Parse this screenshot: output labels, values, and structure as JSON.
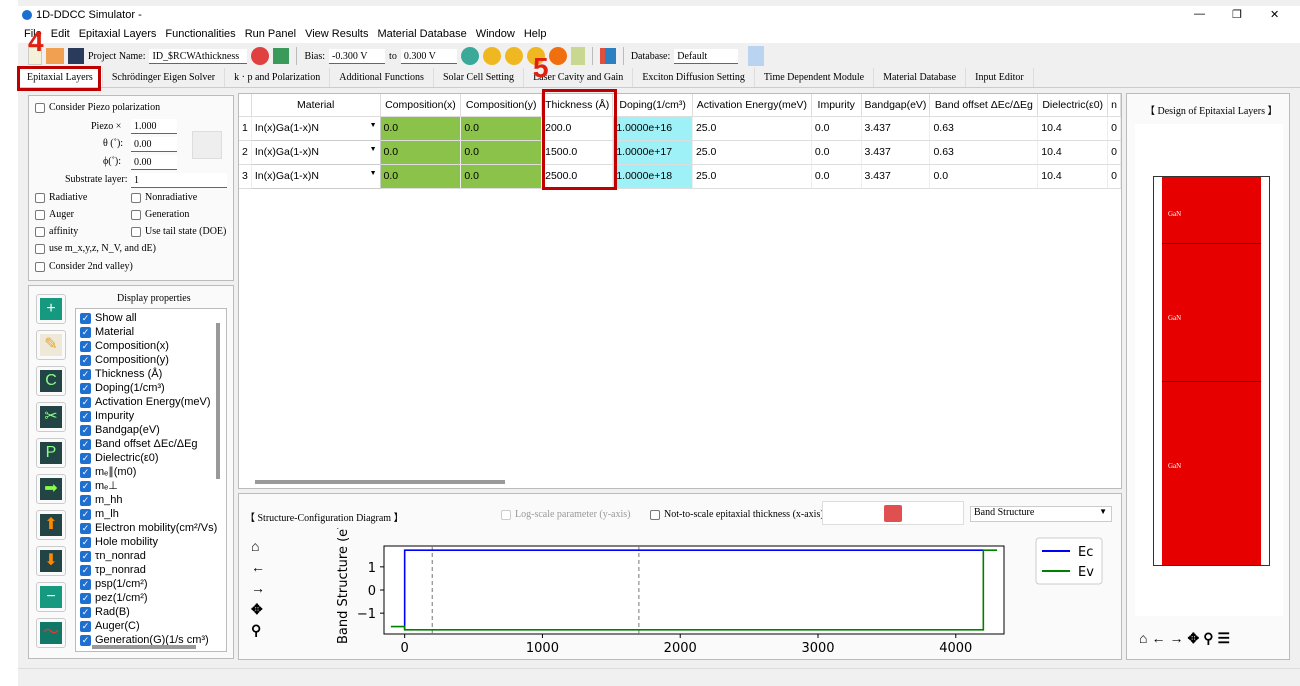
{
  "window": {
    "title": "1D-DDCC Simulator -",
    "controls": [
      "—",
      "❐",
      "✕"
    ]
  },
  "menu": [
    "File",
    "Edit",
    "Epitaxial Layers",
    "Functionalities",
    "Run Panel",
    "View Results",
    "Material Database",
    "Window",
    "Help"
  ],
  "toolbar": {
    "project_label": "Project Name:",
    "project_value": "ID_$RCWAthickness",
    "bias_label": "Bias:",
    "bias_from": "-0.300 V",
    "to_label": "to",
    "bias_to": "0.300 V",
    "database_label": "Database:",
    "database_value": "Default"
  },
  "tabs": [
    "Epitaxial Layers",
    "Schrödinger Eigen Solver",
    "k · p and Polarization",
    "Additional Functions",
    "Solar Cell Setting",
    "Laser Cavity and Gain",
    "Exciton Diffusion Setting",
    "Time Dependent Module",
    "Material Database",
    "Input Editor"
  ],
  "settings": {
    "piezo_check": "Consider Piezo polarization",
    "piezo_label": "Piezo ×",
    "piezo_value": "1.000",
    "theta_label": "θ (˚):",
    "theta_value": "0.00",
    "phi_label": "ϕ(˚):",
    "phi_value": "0.00",
    "substrate_label": "Substrate layer:",
    "substrate_value": "1",
    "checks": [
      "Radiative",
      "Nonradiative",
      "Auger",
      "Generation",
      "affinity",
      "Use tail state (DOE)"
    ],
    "check_mxyz": "use m_x,y,z, N_V, and dE)",
    "check_valley": "Consider 2nd valley)"
  },
  "display_properties": {
    "title": "Display properties",
    "items": [
      "Show all",
      "Material",
      "Composition(x)",
      "Composition(y)",
      "Thickness (Å)",
      "Doping(1/cm³)",
      "Activation Energy(meV)",
      "Impurity",
      "Bandgap(eV)",
      "Band offset ΔEc/ΔEg",
      "Dielectric(ε0)",
      "mₑ∥(m0)",
      "mₑ⊥",
      "m_hh",
      "m_lh",
      "Electron mobility(cm²/Vs)",
      "Hole mobility",
      "τn_nonrad",
      "τp_nonrad",
      "psp(1/cm²)",
      "pez(1/cm²)",
      "Rad(B)",
      "Auger(C)",
      "Generation(G)(1/s cm³)"
    ]
  },
  "side_buttons": [
    "add",
    "edit",
    "copy",
    "cut",
    "paste",
    "insert",
    "move-up",
    "move-down",
    "remove",
    "plot"
  ],
  "table": {
    "columns": [
      "Material",
      "Composition(x)",
      "Composition(y)",
      "Thickness (Å)",
      "Doping(1/cm³)",
      "Activation Energy(meV)",
      "Impurity",
      "Bandgap(eV)",
      "Band offset ΔEc/ΔEg",
      "Dielectric(ε0)",
      "n"
    ],
    "rows": [
      {
        "n": "1",
        "cells": [
          "In(x)Ga(1-x)N",
          "0.0",
          "0.0",
          "200.0",
          "1.0000e+16",
          "25.0",
          "0.0",
          "3.437",
          "0.63",
          "10.4",
          "0"
        ]
      },
      {
        "n": "2",
        "cells": [
          "In(x)Ga(1-x)N",
          "0.0",
          "0.0",
          "1500.0",
          "1.0000e+17",
          "25.0",
          "0.0",
          "3.437",
          "0.63",
          "10.4",
          "0"
        ]
      },
      {
        "n": "3",
        "cells": [
          "In(x)Ga(1-x)N",
          "0.0",
          "0.0",
          "2500.0",
          "1.0000e+18",
          "25.0",
          "0.0",
          "3.437",
          "0.0",
          "10.4",
          "0"
        ]
      }
    ]
  },
  "diagram": {
    "title": "【 Structure-Configuration Diagram 】",
    "log_scale": "Log-scale parameter (y-axis)",
    "not_to_scale": "Not-to-scale epitaxial thickness (x-axis)",
    "select": "Band Structure"
  },
  "design": {
    "title": "【 Design of Epitaxial Layers 】",
    "layers": [
      "GaN",
      "GaN",
      "GaN"
    ]
  },
  "annotations": {
    "a4": "4",
    "a5": "5"
  },
  "colors": {
    "ec": "#0000ff",
    "ev": "#008000",
    "layer": "#e60000",
    "highlight": "#c00000"
  },
  "chart_data": {
    "type": "line",
    "ylabel": "Band Structure (eV)",
    "xlim": [
      -150,
      4350
    ],
    "ylim": [
      -1.9,
      1.9
    ],
    "xticks": [
      "0",
      "1000",
      "2000",
      "3000",
      "4000"
    ],
    "yticks": [
      "1",
      "0",
      "−1"
    ],
    "legend": "top-right outside",
    "series": [
      {
        "name": "Ec",
        "x": [
          0,
          0,
          4200,
          4200
        ],
        "y": [
          -1.72,
          1.72,
          1.72,
          1.72
        ]
      },
      {
        "name": "Ev",
        "x": [
          -100,
          0,
          0,
          4200,
          4200,
          4300
        ],
        "y": [
          -1.58,
          -1.58,
          -1.72,
          -1.72,
          1.72,
          1.72
        ]
      }
    ],
    "vlines": [
      200,
      1700
    ]
  }
}
